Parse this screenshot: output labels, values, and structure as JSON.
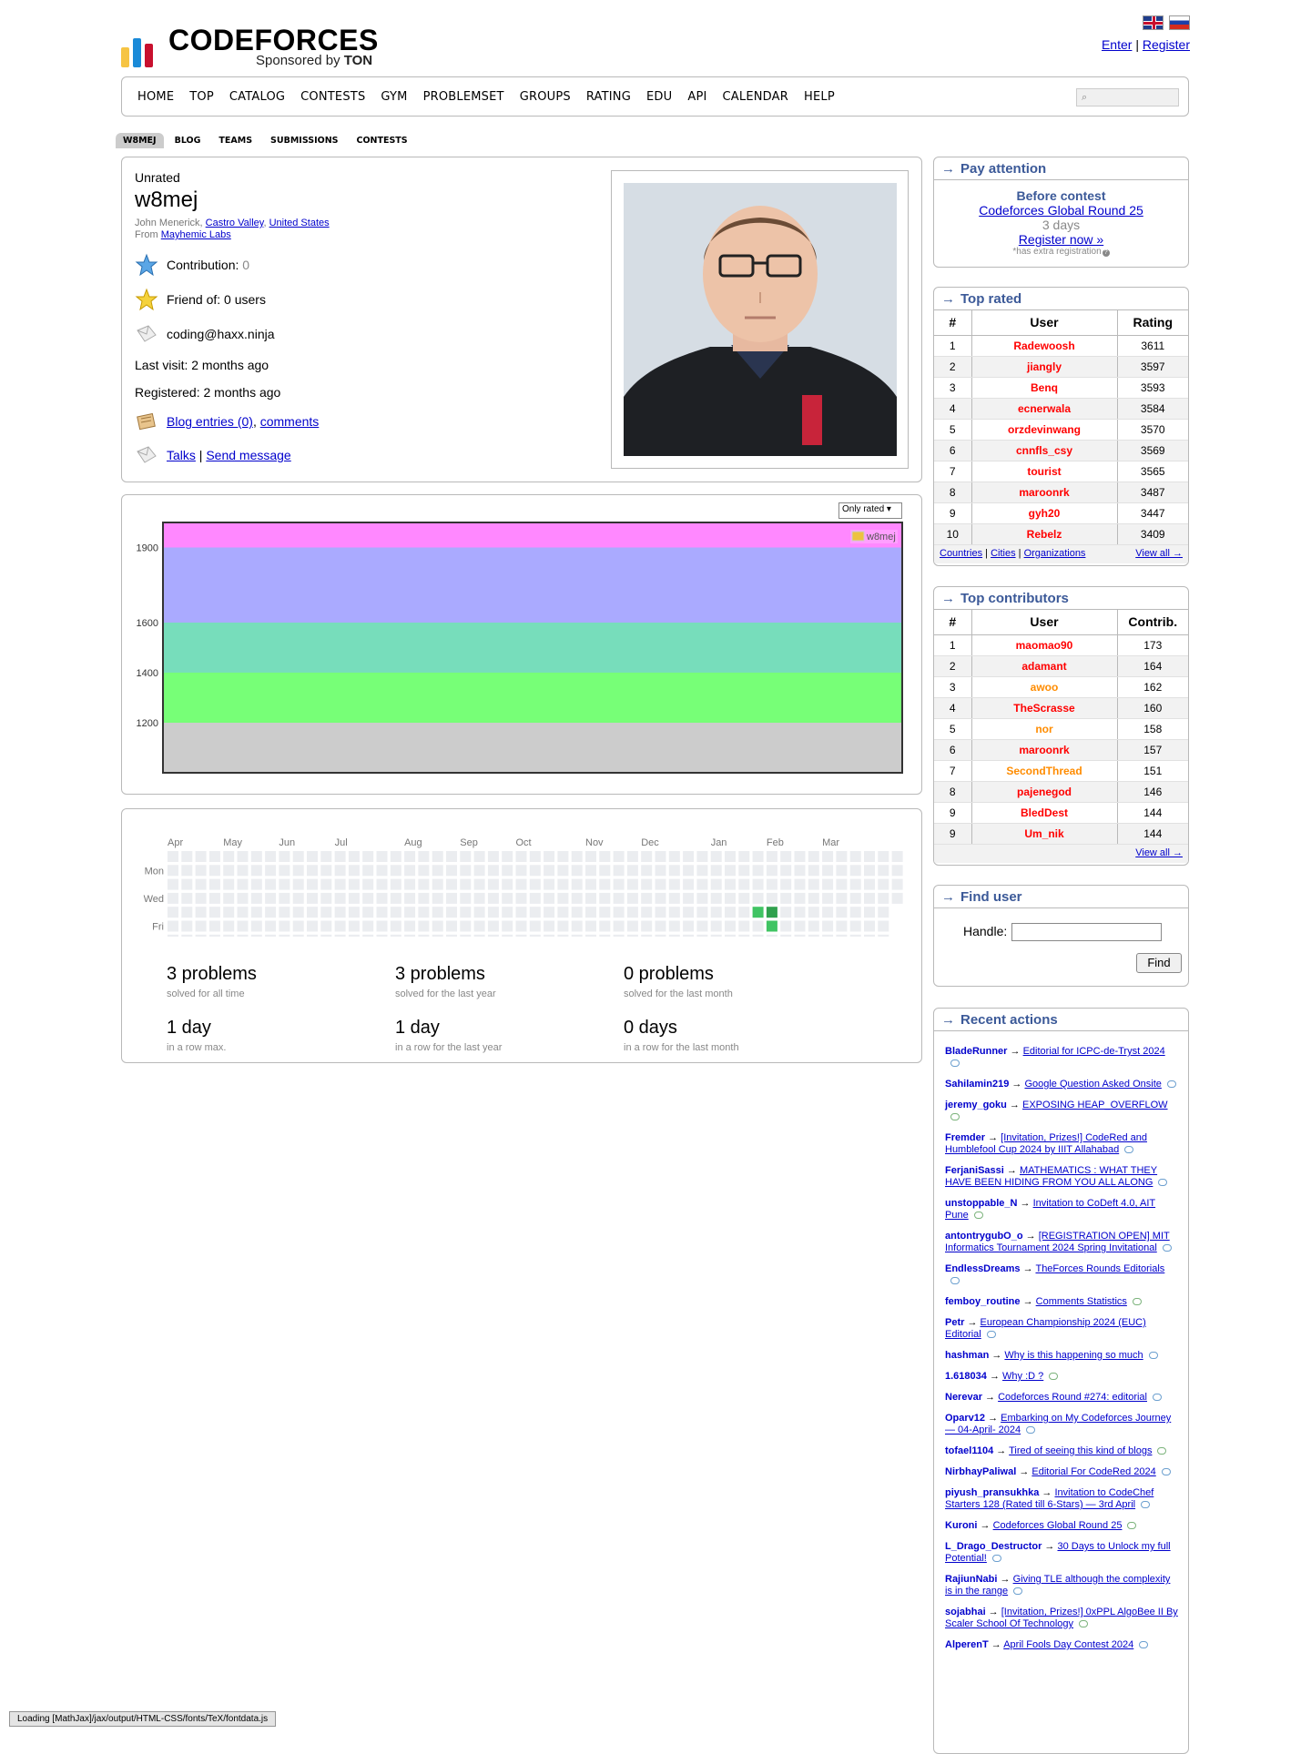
{
  "header": {
    "logo_word": "CODEFORCES",
    "sponsor_prefix": "Sponsored by",
    "sponsor_name": "TON",
    "auth_enter": "Enter",
    "auth_sep": "|",
    "auth_register": "Register"
  },
  "menu": [
    "HOME",
    "TOP",
    "CATALOG",
    "CONTESTS",
    "GYM",
    "PROBLEMSET",
    "GROUPS",
    "RATING",
    "EDU",
    "API",
    "CALENDAR",
    "HELP"
  ],
  "subtabs": [
    "W8MEJ",
    "BLOG",
    "TEAMS",
    "SUBMISSIONS",
    "CONTESTS"
  ],
  "profile": {
    "rank": "Unrated",
    "handle": "w8mej",
    "name": "John Menerick,",
    "city": "Castro Valley",
    "comma": ",",
    "country": "United States",
    "from_label": "From",
    "organization": "Mayhemic Labs",
    "contribution_label": "Contribution:",
    "contribution_value": "0",
    "friend_of": "Friend of: 0 users",
    "email": "coding@haxx.ninja",
    "last_visit": "Last visit: 2 months ago",
    "registered": "Registered: 2 months ago",
    "blog_entries": "Blog entries (0)",
    "blog_comma": ",",
    "comments": "comments",
    "talks": "Talks",
    "talks_sep": "|",
    "send_message": "Send message"
  },
  "rating_chart": {
    "select_value": "Only rated",
    "legend_handle": "w8mej"
  },
  "chart_data": {
    "type": "line",
    "series": [
      {
        "name": "w8mej",
        "values": []
      }
    ],
    "ylim": [
      1000,
      2000
    ],
    "ytick_labels": [
      "1900",
      "1600",
      "1400",
      "1200"
    ],
    "bands": [
      {
        "from": 1000,
        "to": 1200,
        "color": "#cccccc"
      },
      {
        "from": 1200,
        "to": 1400,
        "color": "#77ff77"
      },
      {
        "from": 1400,
        "to": 1600,
        "color": "#77ddbb"
      },
      {
        "from": 1600,
        "to": 1900,
        "color": "#aaaaff"
      },
      {
        "from": 1900,
        "to": 2000,
        "color": "#ff88ff"
      }
    ]
  },
  "activity": {
    "months": [
      "Apr",
      "May",
      "Jun",
      "Jul",
      "Aug",
      "Sep",
      "Oct",
      "Nov",
      "Dec",
      "Jan",
      "Feb",
      "Mar"
    ],
    "days": [
      "Mon",
      "Wed",
      "Fri"
    ],
    "stats": [
      {
        "big": "3 problems",
        "small": "solved for all time"
      },
      {
        "big": "3 problems",
        "small": "solved for the last year"
      },
      {
        "big": "0 problems",
        "small": "solved for the last month"
      },
      {
        "big": "1 day",
        "small": "in a row max."
      },
      {
        "big": "1 day",
        "small": "in a row for the last year"
      },
      {
        "big": "0 days",
        "small": "in a row for the last month"
      }
    ]
  },
  "pay_attention": {
    "title": "Pay attention",
    "before": "Before contest",
    "contest": "Codeforces Global Round 25",
    "days": "3 days",
    "register": "Register now »",
    "note": "*has extra registration"
  },
  "top_rated": {
    "title": "Top rated",
    "headers": [
      "#",
      "User",
      "Rating"
    ],
    "rows": [
      {
        "rank": "1",
        "user": "Radewoosh",
        "value": "3611"
      },
      {
        "rank": "2",
        "user": "jiangly",
        "value": "3597"
      },
      {
        "rank": "3",
        "user": "Benq",
        "value": "3593"
      },
      {
        "rank": "4",
        "user": "ecnerwala",
        "value": "3584"
      },
      {
        "rank": "5",
        "user": "orzdevinwang",
        "value": "3570"
      },
      {
        "rank": "6",
        "user": "cnnfls_csy",
        "value": "3569"
      },
      {
        "rank": "7",
        "user": "tourist",
        "value": "3565"
      },
      {
        "rank": "8",
        "user": "maroonrk",
        "value": "3487"
      },
      {
        "rank": "9",
        "user": "gyh20",
        "value": "3447"
      },
      {
        "rank": "10",
        "user": "Rebelz",
        "value": "3409"
      }
    ],
    "foot_countries": "Countries",
    "foot_cities": "Cities",
    "foot_orgs": "Organizations",
    "foot_sep": "|",
    "view_all": "View all →"
  },
  "top_contributors": {
    "title": "Top contributors",
    "headers": [
      "#",
      "User",
      "Contrib."
    ],
    "rows": [
      {
        "rank": "1",
        "user": "maomao90",
        "value": "173",
        "color": "red"
      },
      {
        "rank": "2",
        "user": "adamant",
        "value": "164",
        "color": "red"
      },
      {
        "rank": "3",
        "user": "awoo",
        "value": "162",
        "color": "orange"
      },
      {
        "rank": "4",
        "user": "TheScrasse",
        "value": "160",
        "color": "red"
      },
      {
        "rank": "5",
        "user": "nor",
        "value": "158",
        "color": "orange"
      },
      {
        "rank": "6",
        "user": "maroonrk",
        "value": "157",
        "color": "legendary"
      },
      {
        "rank": "7",
        "user": "SecondThread",
        "value": "151",
        "color": "orange"
      },
      {
        "rank": "8",
        "user": "pajenegod",
        "value": "146",
        "color": "red"
      },
      {
        "rank": "9",
        "user": "BledDest",
        "value": "144",
        "color": "red"
      },
      {
        "rank": "9",
        "user": "Um_nik",
        "value": "144",
        "color": "legendary"
      }
    ],
    "view_all": "View all →"
  },
  "find_user": {
    "title": "Find user",
    "handle_label": "Handle:",
    "find": "Find"
  },
  "recent_actions": {
    "title": "Recent actions",
    "items": [
      {
        "user": "BladeRunner",
        "color": "violet",
        "link": "Editorial for ICPC-de-Tryst 2024"
      },
      {
        "user": "Sahilamin219",
        "color": "gray",
        "link": "Google Question Asked Onsite"
      },
      {
        "user": "jeremy_goku",
        "color": "green",
        "link": "EXPOSING HEAP_OVERFLOW"
      },
      {
        "user": "Fremder",
        "color": "blue",
        "link": "[Invitation, Prizes!] CodeRed and Humblefool Cup 2024 by IIIT Allahabad"
      },
      {
        "user": "FerjaniSassi",
        "color": "gray",
        "link": "MATHEMATICS : WHAT THEY HAVE BEEN HIDING FROM YOU ALL ALONG"
      },
      {
        "user": "unstoppable_N",
        "color": "orange",
        "link": "Invitation to CoDeft 4.0, AIT Pune"
      },
      {
        "user": "antontrygubO_o",
        "color": "red",
        "link": "[REGISTRATION OPEN] MIT Informatics Tournament 2024 Spring Invitational"
      },
      {
        "user": "EndlessDreams",
        "color": "orange",
        "link": "TheForces Rounds Editorials"
      },
      {
        "user": "femboy_routine",
        "color": "cyan",
        "link": "Comments Statistics"
      },
      {
        "user": "Petr",
        "color": "legendary",
        "link": "European Championship 2024 (EUC) Editorial"
      },
      {
        "user": "hashman",
        "color": "blue",
        "link": "Why is this happening so much"
      },
      {
        "user": "1.618034",
        "color": "blue",
        "link": "Why :D ?"
      },
      {
        "user": "Nerevar",
        "color": "red",
        "link": "Codeforces Round #274: editorial"
      },
      {
        "user": "Oparv12",
        "color": "gray",
        "link": "Embarking on My Codeforces Journey— 04-April- 2024"
      },
      {
        "user": "tofael1104",
        "color": "gray",
        "link": "Tired of seeing this kind of blogs"
      },
      {
        "user": "NirbhayPaliwal",
        "color": "blue",
        "link": "Editorial For CodeRed 2024"
      },
      {
        "user": "piyush_pransukhka",
        "color": "violet",
        "link": "Invitation to CodeChef Starters 128 (Rated till 6-Stars) — 3rd April"
      },
      {
        "user": "Kuroni",
        "color": "red",
        "link": "Codeforces Global Round 25"
      },
      {
        "user": "L_Drago_Destructor",
        "color": "cyan",
        "link": "30 Days to Unlock my full Potential!"
      },
      {
        "user": "RajiunNabi",
        "color": "cyan",
        "link": "Giving TLE although the complexity is in the range"
      },
      {
        "user": "sojabhai",
        "color": "cyan",
        "link": "[Invitation, Prizes!] 0xPPL AlgoBee II By Scaler School Of Technology"
      },
      {
        "user": "AlperenT",
        "color": "orange",
        "link": "April Fools Day Contest 2024"
      }
    ]
  },
  "status": "Loading [MathJax]/jax/output/HTML-CSS/fonts/TeX/fontdata.js"
}
